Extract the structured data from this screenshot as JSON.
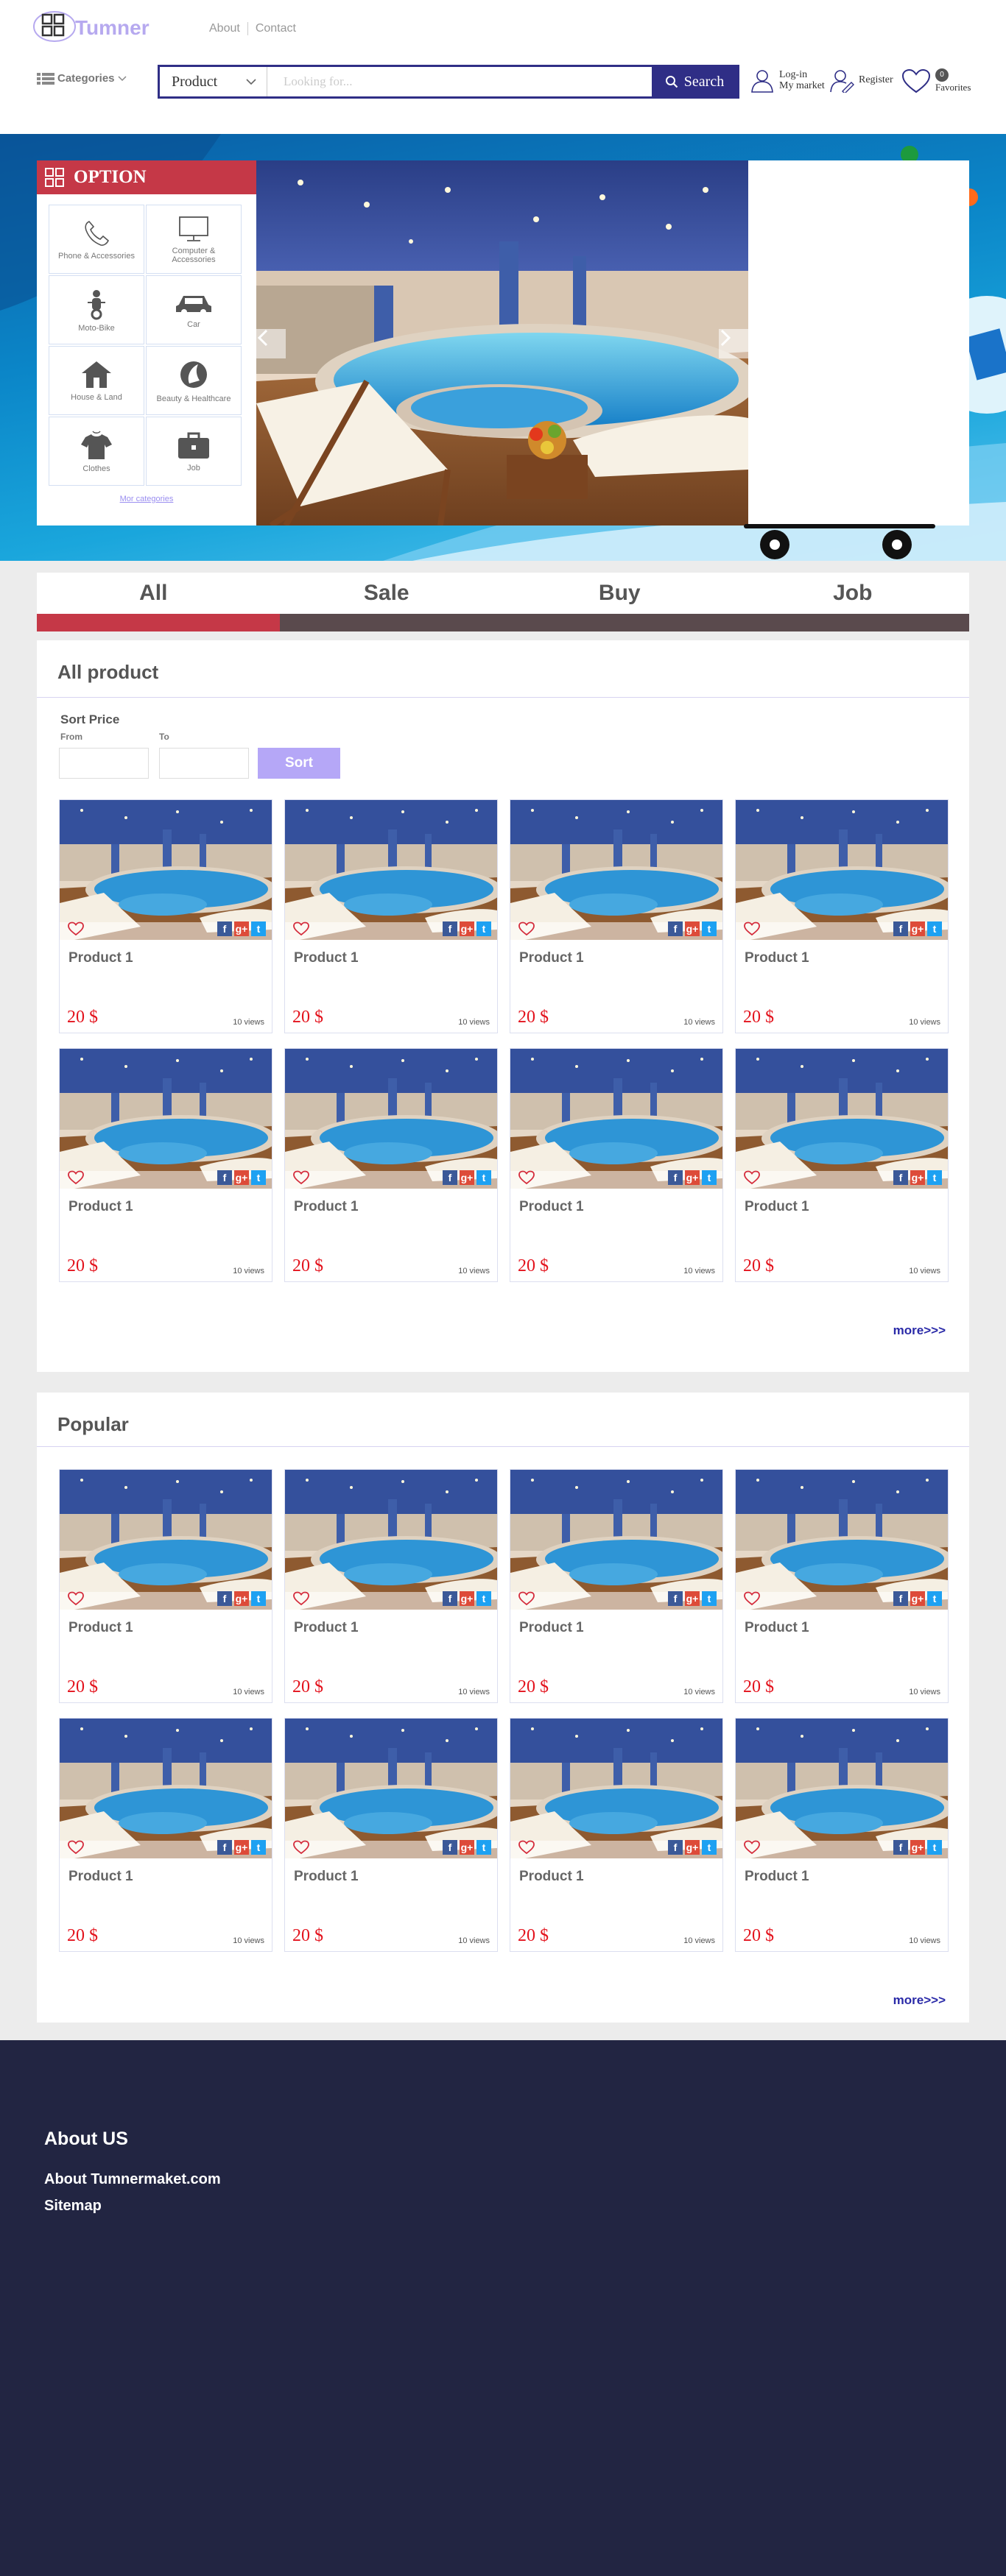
{
  "header": {
    "logo_text": "Tumner",
    "nav": {
      "about": "About",
      "contact": "Contact"
    },
    "categories_label": "Categories",
    "search": {
      "category_value": "Product",
      "placeholder": "Looking for...",
      "button_label": "Search"
    },
    "login": {
      "line1": "Log-in",
      "line2": "My market"
    },
    "register_label": "Register",
    "favorites": {
      "count": "0",
      "label": "Favorites"
    }
  },
  "option_panel": {
    "title": "OPTION",
    "categories": [
      {
        "label": "Phone & Accessories",
        "icon": "phone-icon"
      },
      {
        "label": "Computer & Accessories",
        "icon": "computer-icon"
      },
      {
        "label": "Moto-Bike",
        "icon": "motorbike-icon"
      },
      {
        "label": "Car",
        "icon": "car-icon"
      },
      {
        "label": "House & Land",
        "icon": "house-icon"
      },
      {
        "label": "Beauty & Healthcare",
        "icon": "beauty-icon"
      },
      {
        "label": "Clothes",
        "icon": "clothes-icon"
      },
      {
        "label": "Job",
        "icon": "briefcase-icon"
      }
    ],
    "more_link": "Mor categories"
  },
  "tabs": [
    {
      "label": "All",
      "active": true
    },
    {
      "label": "Sale",
      "active": false
    },
    {
      "label": "Buy",
      "active": false
    },
    {
      "label": "Job",
      "active": false
    }
  ],
  "all_products": {
    "title": "All product",
    "sort": {
      "title": "Sort Price",
      "from_label": "From",
      "to_label": "To",
      "from_value": "",
      "to_value": "",
      "button_label": "Sort"
    },
    "items": [
      {
        "name": "Product 1",
        "price": "20 $",
        "views": "10 views"
      },
      {
        "name": "Product 1",
        "price": "20 $",
        "views": "10 views"
      },
      {
        "name": "Product 1",
        "price": "20 $",
        "views": "10 views"
      },
      {
        "name": "Product 1",
        "price": "20 $",
        "views": "10 views"
      },
      {
        "name": "Product 1",
        "price": "20 $",
        "views": "10 views"
      },
      {
        "name": "Product 1",
        "price": "20 $",
        "views": "10 views"
      },
      {
        "name": "Product 1",
        "price": "20 $",
        "views": "10 views"
      },
      {
        "name": "Product 1",
        "price": "20 $",
        "views": "10 views"
      }
    ],
    "more_label": "more>>>"
  },
  "popular": {
    "title": "Popular",
    "items": [
      {
        "name": "Product 1",
        "price": "20 $",
        "views": "10 views"
      },
      {
        "name": "Product 1",
        "price": "20 $",
        "views": "10 views"
      },
      {
        "name": "Product 1",
        "price": "20 $",
        "views": "10 views"
      },
      {
        "name": "Product 1",
        "price": "20 $",
        "views": "10 views"
      },
      {
        "name": "Product 1",
        "price": "20 $",
        "views": "10 views"
      },
      {
        "name": "Product 1",
        "price": "20 $",
        "views": "10 views"
      },
      {
        "name": "Product 1",
        "price": "20 $",
        "views": "10 views"
      },
      {
        "name": "Product 1",
        "price": "20 $",
        "views": "10 views"
      }
    ],
    "more_label": "more>>>"
  },
  "footer": {
    "title": "About US",
    "links": [
      "About Tumnermaket.com",
      "Sitemap"
    ]
  },
  "colors": {
    "brand_navy": "#2f2e86",
    "accent_red": "#c53847",
    "logo_lavender": "#b6a9ef",
    "price_red": "#e3121c",
    "footer_bg": "#222542",
    "sort_button": "#b5a7f7"
  }
}
